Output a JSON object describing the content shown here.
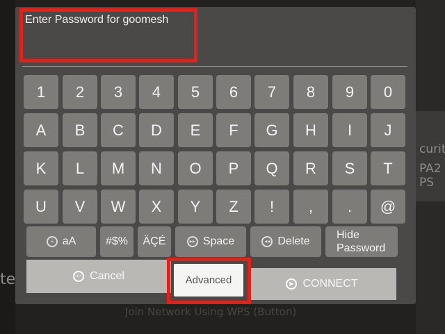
{
  "dialog": {
    "title": "Enter Password for goomesh",
    "password_value": ""
  },
  "keys": {
    "row1": [
      "1",
      "2",
      "3",
      "4",
      "5",
      "6",
      "7",
      "8",
      "9",
      "0"
    ],
    "row2": [
      "A",
      "B",
      "C",
      "D",
      "E",
      "F",
      "G",
      "H",
      "I",
      "J"
    ],
    "row3": [
      "K",
      "L",
      "M",
      "N",
      "O",
      "P",
      "Q",
      "R",
      "S",
      "T"
    ],
    "row4": [
      "U",
      "V",
      "W",
      "X",
      "Y",
      "Z",
      "!",
      ",",
      ".",
      "@"
    ]
  },
  "functions": {
    "case_label": "aA",
    "symbols_label": "#$%",
    "accents_label": "ÄÇÉ",
    "space_label": "Space",
    "delete_label": "Delete",
    "hide_password_label": "Hide Password"
  },
  "actions": {
    "cancel_label": "Cancel",
    "advanced_label": "Advanced",
    "connect_label": "CONNECT"
  },
  "background": {
    "right_text_1": "curity",
    "right_text_2": "PA2 PS",
    "left_text": "te",
    "bottom_text": "Join Network Using WPS (Button)"
  },
  "colors": {
    "highlight": "#e32119",
    "key": "#7d7c79",
    "dialog": "#4a4947"
  }
}
